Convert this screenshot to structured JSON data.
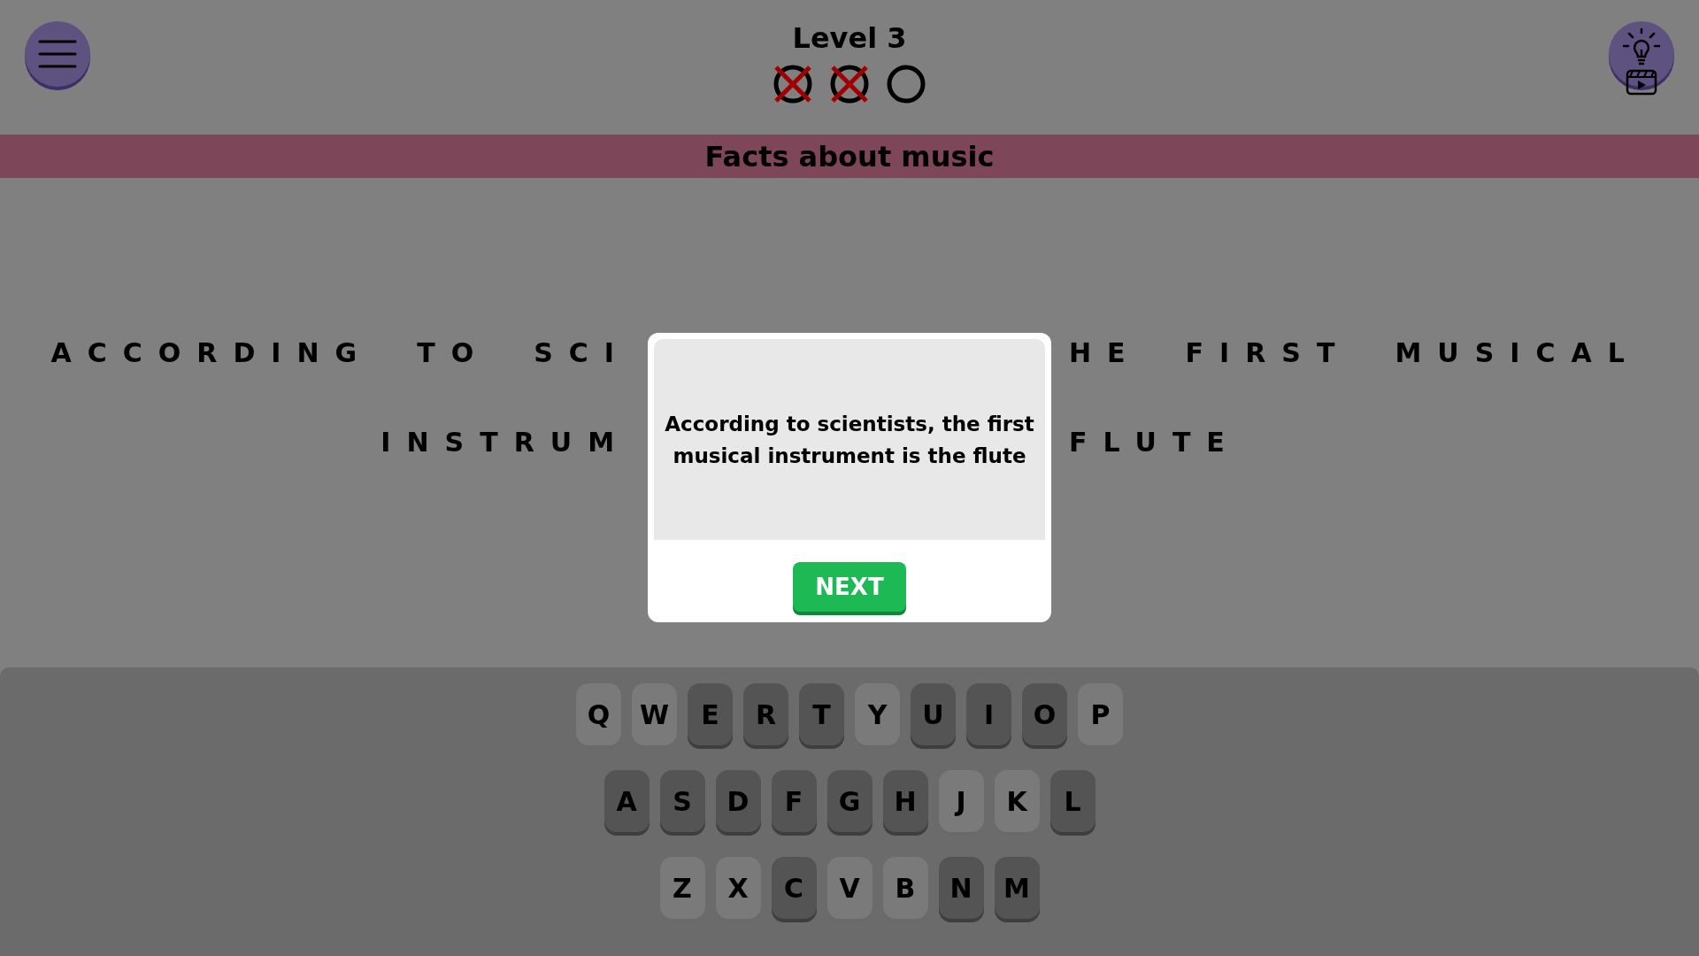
{
  "header": {
    "title": "Level 3",
    "lives": [
      {
        "lost": true
      },
      {
        "lost": true
      },
      {
        "lost": false
      }
    ]
  },
  "category": "Facts about music",
  "puzzle": {
    "lines": [
      {
        "left_words": [
          "ACCORDING",
          "TO",
          "SCI"
        ],
        "right_words": [
          "HE",
          "FIRST",
          "MUSICAL"
        ]
      },
      {
        "left_words": [
          "INSTRUM"
        ],
        "right_words": [
          "FLUTE"
        ]
      }
    ]
  },
  "dialog": {
    "message": "According to scientists, the first musical instrument is the flute",
    "button": "NEXT"
  },
  "keyboard": {
    "rows": [
      [
        {
          "key": "Q",
          "used": false
        },
        {
          "key": "W",
          "used": false
        },
        {
          "key": "E",
          "used": true
        },
        {
          "key": "R",
          "used": true
        },
        {
          "key": "T",
          "used": true
        },
        {
          "key": "Y",
          "used": false
        },
        {
          "key": "U",
          "used": true
        },
        {
          "key": "I",
          "used": true
        },
        {
          "key": "O",
          "used": true
        },
        {
          "key": "P",
          "used": false
        }
      ],
      [
        {
          "key": "A",
          "used": true
        },
        {
          "key": "S",
          "used": true
        },
        {
          "key": "D",
          "used": true
        },
        {
          "key": "F",
          "used": true
        },
        {
          "key": "G",
          "used": true
        },
        {
          "key": "H",
          "used": true
        },
        {
          "key": "J",
          "used": false
        },
        {
          "key": "K",
          "used": false
        },
        {
          "key": "L",
          "used": true
        }
      ],
      [
        {
          "key": "Z",
          "used": false
        },
        {
          "key": "X",
          "used": false
        },
        {
          "key": "C",
          "used": true
        },
        {
          "key": "V",
          "used": false
        },
        {
          "key": "B",
          "used": false
        },
        {
          "key": "N",
          "used": true
        },
        {
          "key": "M",
          "used": true
        }
      ]
    ]
  }
}
